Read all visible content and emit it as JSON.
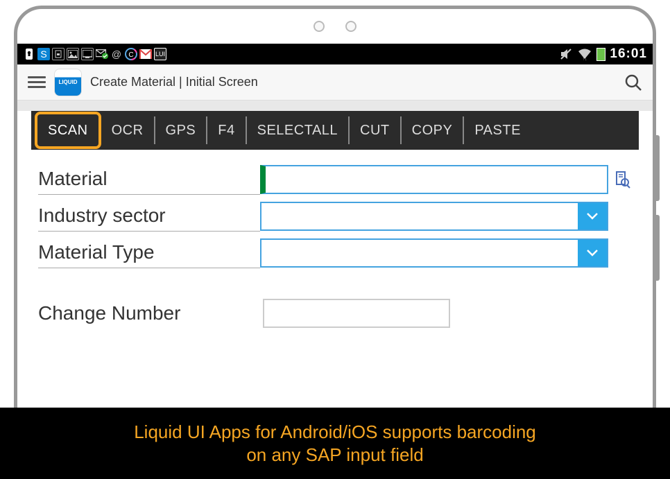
{
  "status_bar": {
    "time": "16:01"
  },
  "app_header": {
    "logo_text": "LIQUID",
    "title": "Create Material  | Initial Screen"
  },
  "context_toolbar": {
    "items": [
      "SCAN",
      "OCR",
      "GPS",
      "F4",
      "SELECTALL",
      "CUT",
      "COPY",
      "PASTE"
    ],
    "highlighted_index": 0
  },
  "form": {
    "material": {
      "label": "Material",
      "value": ""
    },
    "industry_sector": {
      "label": "Industry sector",
      "value": ""
    },
    "material_type": {
      "label": "Material Type",
      "value": ""
    },
    "change_number": {
      "label": "Change Number",
      "value": ""
    }
  },
  "caption": {
    "line1": "Liquid UI Apps for Android/iOS supports barcoding",
    "line2": "on any SAP input field"
  }
}
